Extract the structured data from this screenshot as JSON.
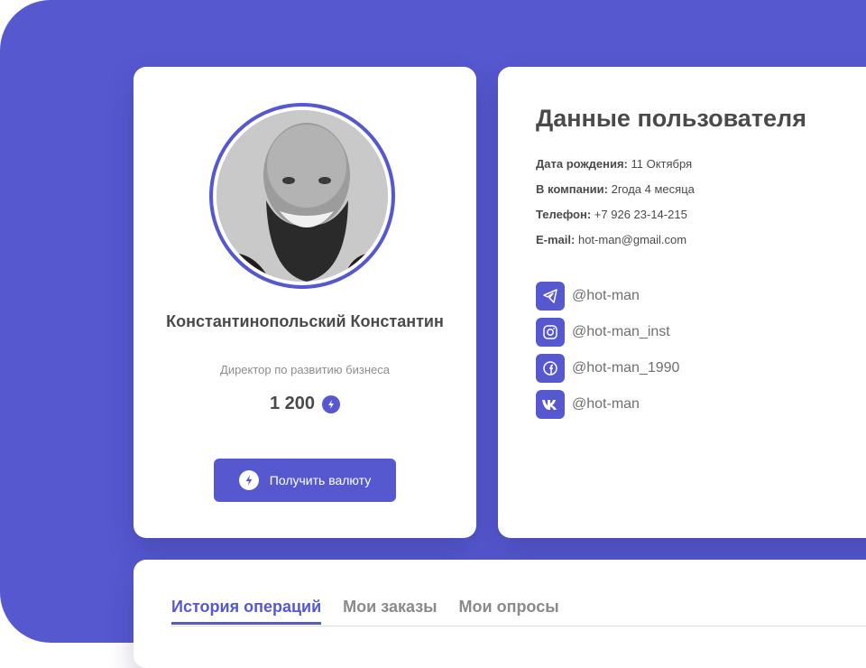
{
  "profile": {
    "name": "Константинопольский Константин",
    "role": "Директор по развитию бизнеса",
    "balance": "1 200",
    "button_label": "Получить валюту"
  },
  "info": {
    "title": "Данные пользователя",
    "fields": [
      {
        "label": "Дата рождения:",
        "value": "11 Октября"
      },
      {
        "label": "В компании:",
        "value": "2года 4 месяца"
      },
      {
        "label": "Телефон:",
        "value": "+7 926 23-14-215"
      },
      {
        "label": "E-mail:",
        "value": "hot-man@gmail.com"
      }
    ],
    "socials": [
      {
        "icon": "telegram-icon",
        "handle": "@hot-man"
      },
      {
        "icon": "instagram-icon",
        "handle": "@hot-man_inst"
      },
      {
        "icon": "facebook-icon",
        "handle": "@hot-man_1990"
      },
      {
        "icon": "vk-icon",
        "handle": "@hot-man"
      }
    ]
  },
  "tabs": [
    "История операций",
    "Мои заказы",
    "Мои опросы"
  ],
  "colors": {
    "accent": "#5658d0",
    "text": "#4a4a4a",
    "muted": "#8d8d8d"
  }
}
